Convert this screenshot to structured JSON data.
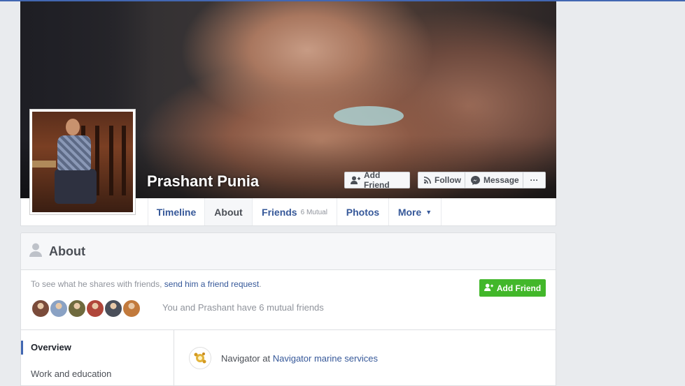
{
  "profile": {
    "name": "Prashant Punia"
  },
  "cover_actions": {
    "add_friend": "Add Friend",
    "follow": "Follow",
    "message": "Message",
    "more": "···"
  },
  "tabs": [
    {
      "label": "Timeline",
      "sub": ""
    },
    {
      "label": "About",
      "sub": ""
    },
    {
      "label": "Friends",
      "sub": "6 Mutual"
    },
    {
      "label": "Photos",
      "sub": ""
    },
    {
      "label": "More",
      "sub": ""
    }
  ],
  "active_tab": "About",
  "about": {
    "title": "About",
    "share_prefix": "To see what he shares with friends, ",
    "share_link": "send him a friend request",
    "share_suffix": ".",
    "add_friend": "Add Friend",
    "mutual_text": "You and Prashant have 6 mutual friends",
    "mutual_avatars": [
      "#7a4b3a",
      "#8aa2c4",
      "#6f6a3e",
      "#b0463a",
      "#4a4f5a",
      "#c27a3c"
    ]
  },
  "sidebar": {
    "items": [
      "Overview",
      "Work and education"
    ]
  },
  "work": {
    "prefix": "Navigator at ",
    "company": "Navigator marine services"
  },
  "colors": {
    "brand_blue": "#4267b2",
    "link": "#365899",
    "green": "#42b72a",
    "page_bg": "#e9ebee"
  }
}
